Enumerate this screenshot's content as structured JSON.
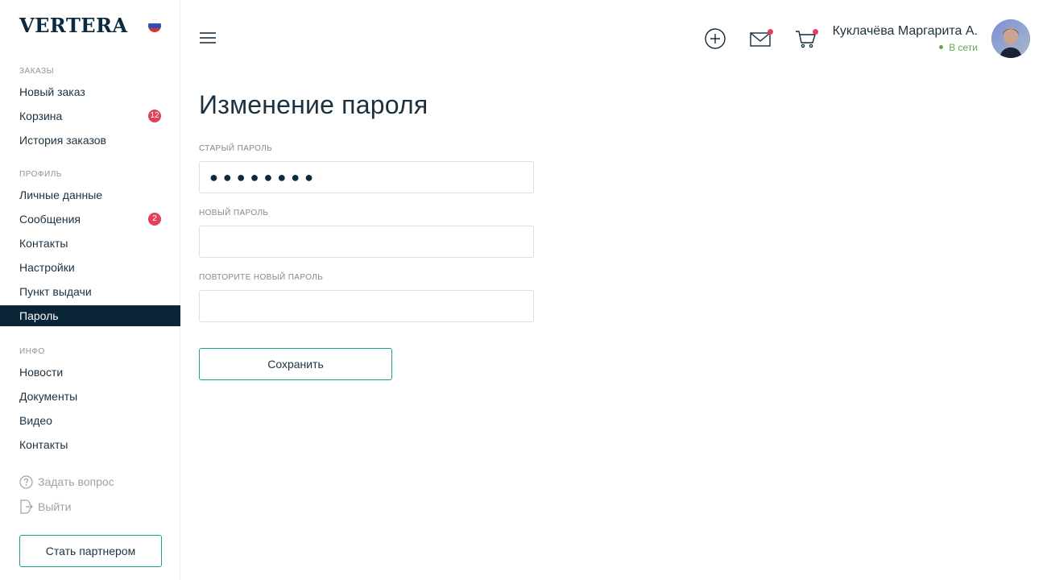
{
  "app": {
    "logo": "VERTERA",
    "language": "ru"
  },
  "sidebar": {
    "orders": {
      "title": "ЗАКАЗЫ",
      "items": [
        {
          "label": "Новый заказ"
        },
        {
          "label": "Корзина",
          "badge": "12"
        },
        {
          "label": "История заказов"
        }
      ]
    },
    "profile": {
      "title": "ПРОФИЛЬ",
      "items": [
        {
          "label": "Личные данные"
        },
        {
          "label": "Сообщения",
          "badge": "2"
        },
        {
          "label": "Контакты"
        },
        {
          "label": "Настройки"
        },
        {
          "label": "Пункт выдачи"
        },
        {
          "label": "Пароль",
          "active": true
        }
      ]
    },
    "info": {
      "title": "ИНФО",
      "items": [
        {
          "label": "Новости"
        },
        {
          "label": "Документы"
        },
        {
          "label": "Видео"
        },
        {
          "label": "Контакты"
        }
      ]
    },
    "ask_question": "Задать вопрос",
    "logout": "Выйти",
    "partner_button": "Стать партнером"
  },
  "header": {
    "icons": [
      "menu-icon",
      "add-circle-icon",
      "mail-icon",
      "cart-icon"
    ],
    "user_name": "Куклачёва Маргарита А.",
    "user_status": "В сети"
  },
  "main": {
    "title": "Изменение пароля",
    "old_password": {
      "label": "СТАРЫЙ ПАРОЛЬ",
      "value": "●●●●●●●●"
    },
    "new_password": {
      "label": "НОВЫЙ ПАРОЛЬ",
      "value": ""
    },
    "repeat_password": {
      "label": "ПОВТОРИТЕ НОВЫЙ ПАРОЛЬ",
      "value": ""
    },
    "save_button": "Сохранить"
  },
  "colors": {
    "accent": "#1b9c8f",
    "active_nav": "#0b2538",
    "badge": "#e0405e",
    "online": "#5fa84e"
  }
}
